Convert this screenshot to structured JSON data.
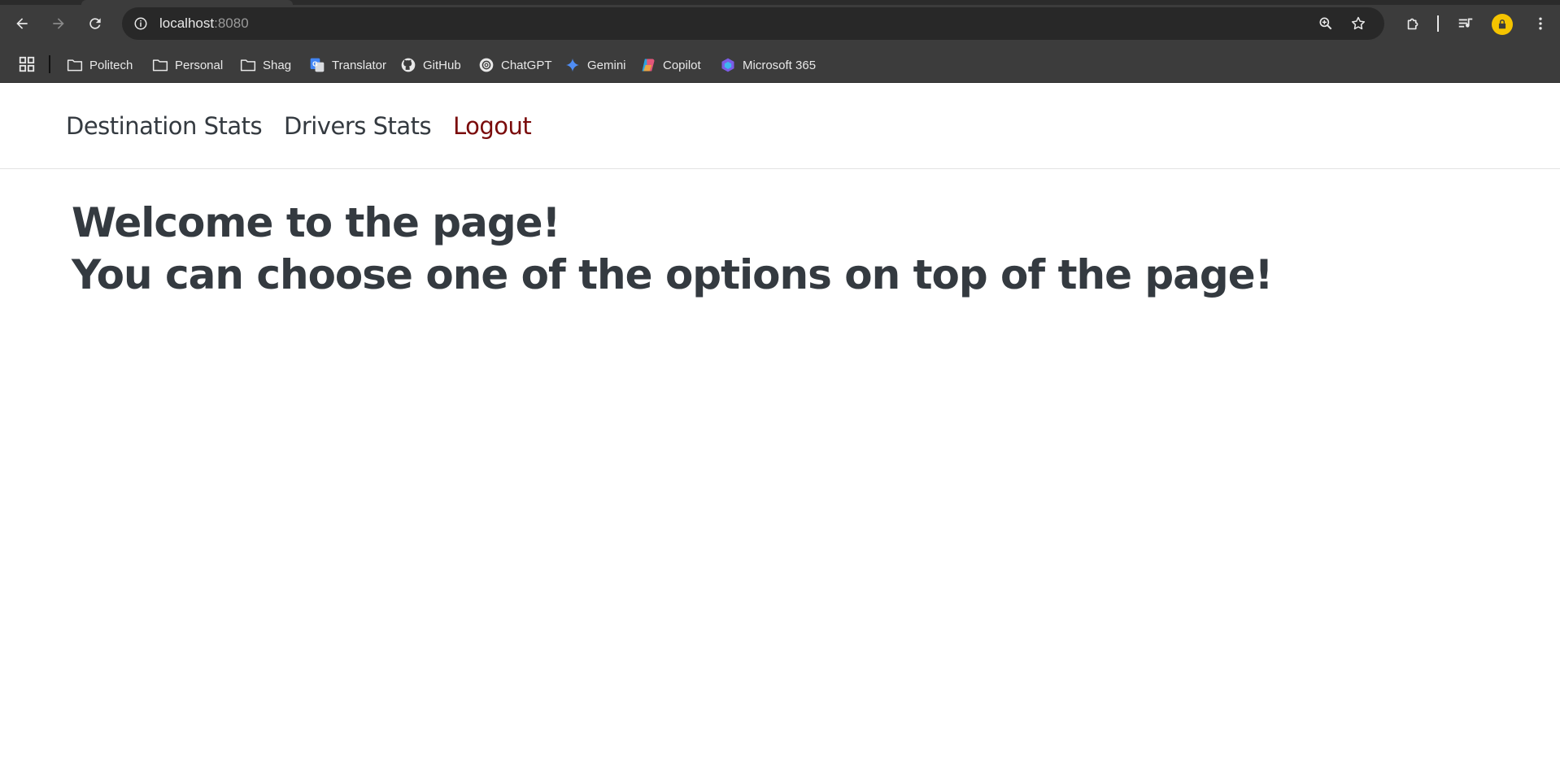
{
  "browser": {
    "url_host": "localhost",
    "url_port": ":8080",
    "bookmarks": [
      {
        "label": "Politech",
        "icon": "folder-icon"
      },
      {
        "label": "Personal",
        "icon": "folder-icon"
      },
      {
        "label": "Shag",
        "icon": "folder-icon"
      },
      {
        "label": "Translator",
        "icon": "translate-icon"
      },
      {
        "label": "GitHub",
        "icon": "github-icon"
      },
      {
        "label": "ChatGPT",
        "icon": "chatgpt-icon"
      },
      {
        "label": "Gemini",
        "icon": "gemini-icon"
      },
      {
        "label": "Copilot",
        "icon": "copilot-icon"
      },
      {
        "label": "Microsoft 365",
        "icon": "microsoft365-icon"
      }
    ],
    "colors": {
      "chrome_bg": "#3c3c3c",
      "omnibox_bg": "#282828",
      "avatar": "#f5c400"
    }
  },
  "nav": {
    "destination_stats": "Destination Stats",
    "drivers_stats": "Drivers Stats",
    "logout": "Logout",
    "logout_color": "#7a0b0b"
  },
  "main": {
    "welcome_line1": "Welcome to the page!",
    "welcome_line2": "You can choose one of the options on top of the page!"
  }
}
